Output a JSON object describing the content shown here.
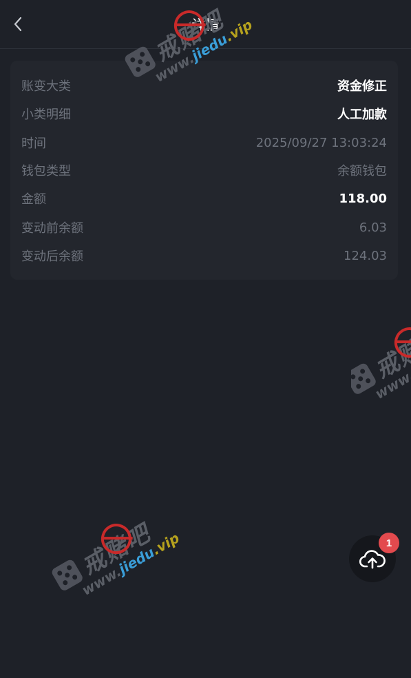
{
  "header": {
    "title": "详情",
    "back_icon": "chevron-left-icon"
  },
  "details": {
    "rows": [
      {
        "label": "账变大类",
        "value": "资金修正"
      },
      {
        "label": "小类明细",
        "value": "人工加款"
      },
      {
        "label": "时间",
        "value": "2025/09/27 13:03:24"
      },
      {
        "label": "钱包类型",
        "value": "余额钱包"
      },
      {
        "label": "金额",
        "value": "118.00"
      },
      {
        "label": "变动前余额",
        "value": "6.03"
      },
      {
        "label": "变动后余额",
        "value": "124.03"
      }
    ]
  },
  "fab": {
    "icon": "cloud-upload-icon",
    "badge": "1"
  },
  "watermark": {
    "brand": "戒赌吧",
    "site_prefix": "www.",
    "site_name": "jiedu",
    "site_suffix": ".vip"
  },
  "colors": {
    "background": "#1e2128",
    "card": "#23262d",
    "muted_text": "#6d727c",
    "badge": "#e34a4e"
  }
}
